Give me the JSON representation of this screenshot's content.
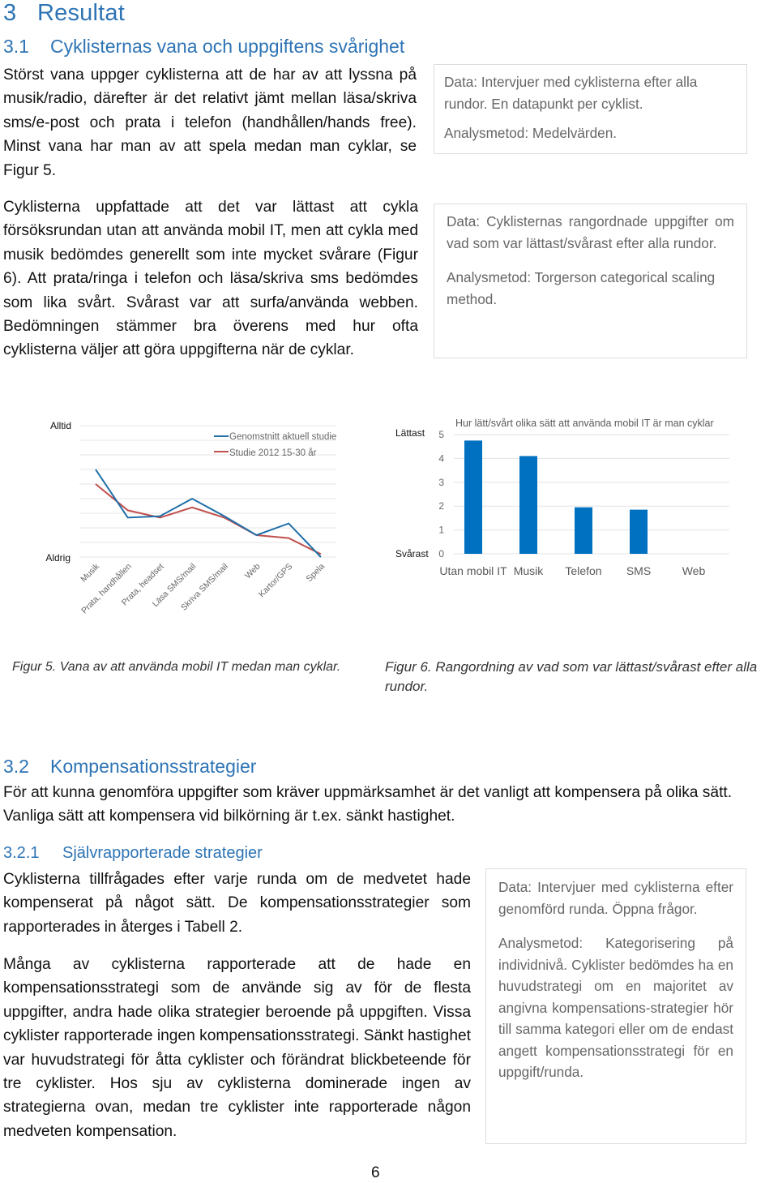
{
  "headings": {
    "h1": {
      "number": "3",
      "title": "Resultat"
    },
    "h2_1": {
      "number": "3.1",
      "title": "Cyklisternas vana och uppgiftens svårighet"
    },
    "h2_2": {
      "number": "3.2",
      "title": "Kompensationsstrategier"
    },
    "h3_1": {
      "number": "3.2.1",
      "title": "Självrapporterade strategier"
    }
  },
  "paragraphs": {
    "p1": "Störst vana uppger cyklisterna att de har av att lyssna på musik/radio, därefter är det relativt jämt mellan läsa/skriva sms/e-post och prata i telefon (handhållen/hands free). Minst vana har man av att spela medan man cyklar, se Figur 5.",
    "p2": "Cyklisterna uppfattade att det var lättast att cykla försöksrundan utan att använda mobil IT, men att cykla med musik bedömdes generellt som inte mycket svårare (Figur 6). Att prata/ringa i telefon och läsa/skriva sms bedömdes som lika svårt. Svårast var att surfa/använda webben. Bedömningen stämmer bra överens med hur ofta cyklisterna väljer att göra uppgifterna när de cyklar.",
    "p3": "För att kunna genomföra uppgifter som kräver uppmärksamhet är det vanligt att kompensera på olika sätt. Vanliga sätt att kompensera vid bilkörning är t.ex. sänkt hastighet.",
    "p4": "Cyklisterna tillfrågades efter varje runda om de medvetet hade kompenserat på något sätt. De kompensationsstrategier som rapporterades in återges i Tabell 2.",
    "p5": "Många av cyklisterna rapporterade att de hade en kompensationsstrategi som de använde sig av för de flesta uppgifter, andra hade olika strategier beroende på uppgiften. Vissa cyklister rapporterade ingen kompensationsstrategi. Sänkt hastighet var huvudstrategi för åtta cyklister och förändrat blickbeteende för tre cyklister. Hos sju av cyklisterna dominerade ingen av strategierna ovan, medan tre cyklister inte rapporterade någon medveten kompensation."
  },
  "boxes": {
    "box1": {
      "data": "Data: Intervjuer med cyklisterna efter alla rundor. En datapunkt per cyklist.",
      "method": "Analysmetod: Medelvärden."
    },
    "box2": {
      "data": "Data: Cyklisternas rangordnade uppgifter om vad som var lättast/svårast efter alla rundor.",
      "method": "Analysmetod: Torgerson categorical scaling method."
    },
    "box3": {
      "data": "Data: Intervjuer med cyklisterna efter genomförd runda. Öppna frågor.",
      "method": "Analysmetod: Kategorisering på individnivå. Cyklister bedömdes ha en huvudstrategi om en majoritet av angivna kompensations-strategier hör till samma kategori eller om de endast angett kompensationsstrategi för en uppgift/runda."
    }
  },
  "captions": {
    "fig5": "Figur 5. Vana av att använda mobil IT medan man cyklar.",
    "fig6": "Figur 6. Rangordning av vad som var lättast/svårast efter alla rundor."
  },
  "page_number": "6",
  "colors": {
    "heading": "#2e74b5",
    "series_blue": "#1f6fa8",
    "series_red": "#c0504d",
    "bar": "#0070c0",
    "grid": "#e6e6e6"
  },
  "chart_data": [
    {
      "type": "line",
      "title": "",
      "categories": [
        "Musik",
        "Prata, handhållen",
        "Prata, headset",
        "Läsa SMS/mail",
        "Skriva SMS/mail",
        "Web",
        "Kartor/GPS",
        "Spela"
      ],
      "series": [
        {
          "name": "Genomstnitt aktuell studie",
          "values": [
            6.0,
            2.7,
            2.8,
            4.0,
            2.8,
            1.5,
            2.3,
            0.0
          ]
        },
        {
          "name": "Studie 2012 15-30 år",
          "values": [
            5.0,
            3.2,
            2.7,
            3.4,
            2.7,
            1.5,
            1.3,
            0.2
          ]
        }
      ],
      "ylim": [
        0,
        9
      ],
      "y_tick_labels": {
        "top": "Alltid",
        "bottom": "Aldrig"
      },
      "grid": true,
      "legend": "top-right",
      "xlabel": "",
      "ylabel": ""
    },
    {
      "type": "bar",
      "title": "Hur lätt/svårt olika sätt att använda mobil IT är man cyklar",
      "categories": [
        "Utan mobil IT",
        "Musik",
        "Telefon",
        "SMS",
        "Web"
      ],
      "values": [
        4.75,
        4.1,
        1.95,
        1.85,
        0
      ],
      "ylim": [
        0,
        5
      ],
      "yticks": [
        "0",
        "1",
        "2",
        "3",
        "4",
        "5"
      ],
      "y_side_labels": {
        "top": "Lättast",
        "bottom": "Svårast"
      },
      "grid": true,
      "xlabel": "",
      "ylabel": ""
    }
  ]
}
